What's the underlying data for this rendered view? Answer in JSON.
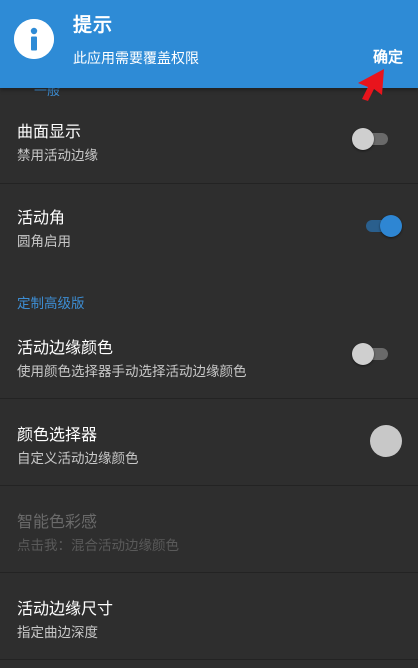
{
  "toast": {
    "title": "提示",
    "message": "此应用需要覆盖权限",
    "ok_label": "确定"
  },
  "partial_section_header": "一般",
  "settings": [
    {
      "title": "曲面显示",
      "subtitle": "禁用活动边缘",
      "switch": "off"
    },
    {
      "title": "活动角",
      "subtitle": "圆角启用",
      "switch": "on"
    },
    {
      "title": "活动边缘颜色",
      "subtitle": "使用颜色选择器手动选择活动边缘颜色",
      "switch": "off"
    },
    {
      "title": "颜色选择器",
      "subtitle": "自定义活动边缘颜色",
      "color": "#c8c8c8"
    },
    {
      "title": "智能色彩感",
      "subtitle": "点击我：混合活动边缘颜色",
      "disabled": true
    },
    {
      "title": "活动边缘尺寸",
      "subtitle": "指定曲边深度"
    }
  ],
  "section_custom": "定制高级版",
  "colors": {
    "banner": "#2e8bd6",
    "accent": "#3d8ed4",
    "background": "#2e2e2e",
    "switch_on": "#2e86d3",
    "pointer": "#e8141c"
  }
}
